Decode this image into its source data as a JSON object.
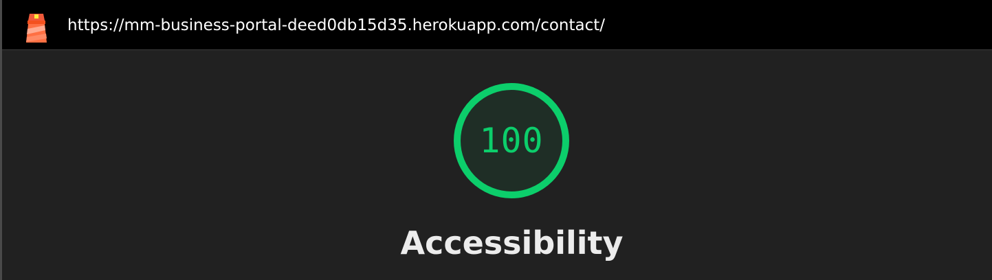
{
  "header": {
    "url": "https://mm-business-portal-deed0db15d35.herokuapp.com/contact/",
    "logo_icon": "lighthouse-icon"
  },
  "gauge": {
    "score": "100",
    "score_fraction": 1.0,
    "color": "#0cce6b",
    "fill_color": "#1f2e26"
  },
  "category": {
    "title": "Accessibility"
  }
}
